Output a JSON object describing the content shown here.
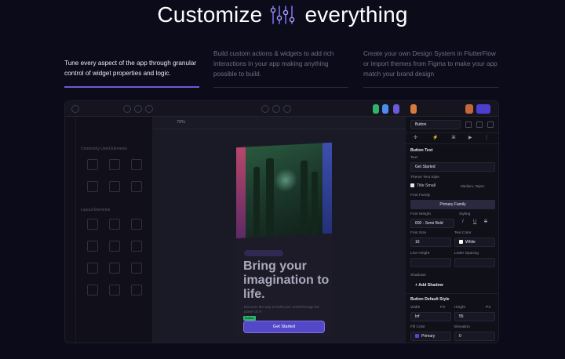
{
  "hero": {
    "word_1": "Customize",
    "word_2": "everything"
  },
  "features": [
    {
      "text": "Tune every aspect of the app through granular control of widget properties and logic.",
      "active": true
    },
    {
      "text": "Build custom actions & widgets to add rich interactions in your app making anything possible to build.",
      "active": false
    },
    {
      "text": "Create your own Design System in FlutterFlow or import themes from Figma to make your app match your brand design",
      "active": false
    }
  ],
  "editor": {
    "zoom": "70%",
    "left_panel": {
      "section_1": "Commonly Used Elements",
      "section_2": "Layout Elements"
    },
    "phone": {
      "headline": "Bring your imagination to life.",
      "subtext": "Discover the way to build your world through the power of AI",
      "selected_tag": "Button",
      "cta_label": "Get Started"
    },
    "properties": {
      "widget_name": "Button",
      "section_button_text": "Button Text",
      "text_label": "Text",
      "text_value": "Get Started",
      "theme_text_style_label": "Theme Text Style",
      "theme_text_style_value": "Title Small",
      "theme_text_style_font": "Medium, Tejarv",
      "font_family_label": "Font Family",
      "font_family_value": "Primary Family",
      "font_weight_label": "Font Weight",
      "font_weight_value": "600 - Semi Bold",
      "styling_label": "Styling",
      "font_size_label": "Font Size",
      "font_size_value": "16",
      "text_color_label": "Text Color",
      "text_color_value": "White",
      "line_height_label": "Line Height",
      "letter_spacing_label": "Letter Spacing",
      "shadows_label": "Shadows",
      "add_shadow_label": "Add Shadow",
      "section_default_style": "Button Default Style",
      "width_label": "Width",
      "width_value": "Inf",
      "height_label": "Height",
      "height_value": "55",
      "unit_label": "PX",
      "fill_color_label": "Fill Color",
      "fill_color_value": "Primary",
      "elevation_label": "Elevation",
      "elevation_value": "0"
    }
  },
  "colors": {
    "background": "#0c0b1a",
    "accent": "#6b5ad9",
    "cta": "#5548c8",
    "selected": "#2fb36c"
  }
}
